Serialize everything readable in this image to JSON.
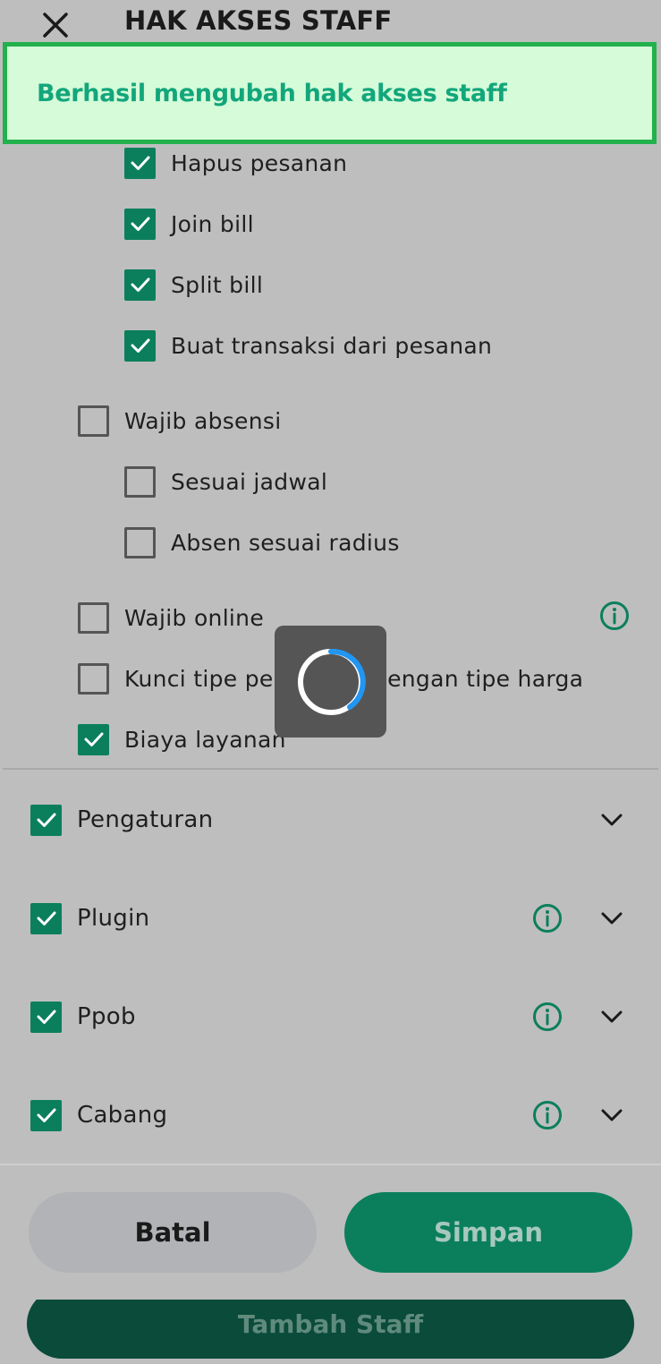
{
  "header": {
    "title": "HAK AKSES STAFF",
    "close_icon": "close-icon"
  },
  "toast": {
    "message": "Berhasil mengubah hak akses staff"
  },
  "permissions": [
    {
      "label": "Hapus pesanan",
      "checked": true
    },
    {
      "label": "Join bill",
      "checked": true
    },
    {
      "label": "Split bill",
      "checked": true
    },
    {
      "label": "Buat transaksi dari pesanan",
      "checked": true
    },
    {
      "label": "Wajib absensi",
      "checked": false
    },
    {
      "label": "Sesuai jadwal",
      "checked": false
    },
    {
      "label": "Absen sesuai radius",
      "checked": false
    },
    {
      "label": "Wajib online",
      "checked": false,
      "icon": "info-icon"
    },
    {
      "label": "Kunci tipe pelanggan dengan tipe harga",
      "checked": false
    },
    {
      "label": "Biaya layanan",
      "checked": true
    }
  ],
  "sections": [
    {
      "label": "Pengaturan",
      "checked": true,
      "info": false
    },
    {
      "label": "Plugin",
      "checked": true,
      "info": true
    },
    {
      "label": "Ppob",
      "checked": true,
      "info": true
    },
    {
      "label": "Cabang",
      "checked": true,
      "info": true
    }
  ],
  "footer": {
    "cancel_label": "Batal",
    "save_label": "Simpan"
  },
  "underlay": {
    "add_staff_label": "Tambah Staff"
  },
  "colors": {
    "accent": "#0b7f5c",
    "toast_bg": "#d5fbd8",
    "toast_border": "#22b14c",
    "toast_text": "#12a67b",
    "spinner": "#2196f3"
  }
}
